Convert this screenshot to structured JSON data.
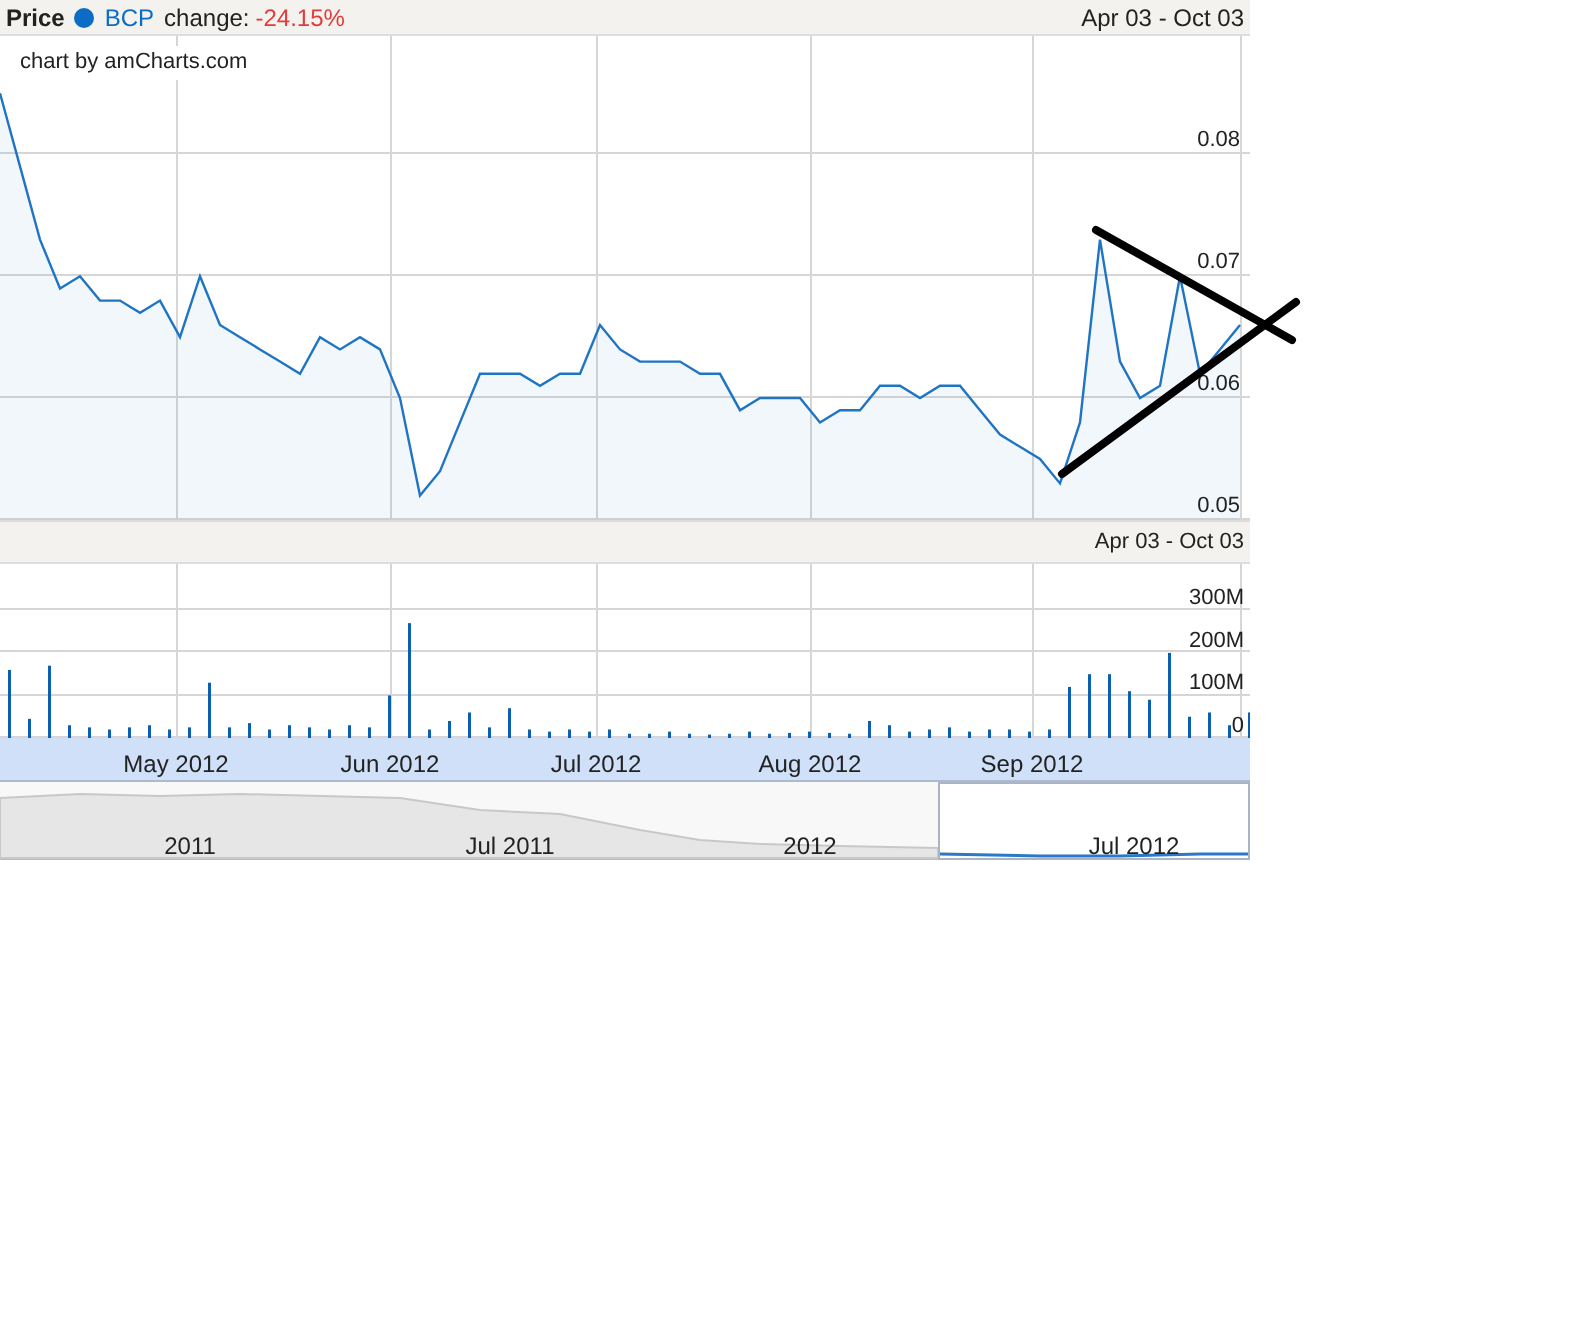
{
  "price_panel": {
    "title": "Price",
    "legend": {
      "color": "#0a6cc4",
      "change_label": "change:",
      "change": "-24.15%"
    },
    "range": "Apr 03 - Oct 03",
    "credit": "chart by amCharts.com",
    "chart_data": {
      "type": "area",
      "grid": true,
      "ylim": [
        0.05,
        0.0897
      ],
      "yticks": [
        {
          "value": 0.05,
          "label": "0.05"
        },
        {
          "value": 0.06,
          "label": "0.06"
        },
        {
          "value": 0.07,
          "label": "0.07"
        },
        {
          "value": 0.08,
          "label": "0.08"
        }
      ],
      "series": [
        {
          "name": "BCP",
          "color": "#1f74c4",
          "values": [
            0.085,
            0.079,
            0.073,
            0.069,
            0.07,
            0.068,
            0.068,
            0.067,
            0.068,
            0.065,
            0.07,
            0.066,
            0.065,
            0.064,
            0.063,
            0.062,
            0.065,
            0.064,
            0.065,
            0.064,
            0.06,
            0.052,
            0.054,
            0.058,
            0.062,
            0.062,
            0.062,
            0.061,
            0.062,
            0.062,
            0.066,
            0.064,
            0.063,
            0.063,
            0.063,
            0.062,
            0.062,
            0.059,
            0.06,
            0.06,
            0.06,
            0.058,
            0.059,
            0.059,
            0.061,
            0.061,
            0.06,
            0.061,
            0.061,
            0.059,
            0.057,
            0.056,
            0.055,
            0.053,
            0.058,
            0.073,
            0.063,
            0.06,
            0.061,
            0.07,
            0.062,
            0.064,
            0.066
          ]
        }
      ]
    }
  },
  "volume_panel": {
    "range": "Apr 03 - Oct 03",
    "chart_data": {
      "type": "bar",
      "grid": true,
      "ylim": [
        0,
        409
      ],
      "yticks": [
        {
          "value": 0,
          "label": "0"
        },
        {
          "value": 100,
          "label": "100M"
        },
        {
          "value": 200,
          "label": "200M"
        },
        {
          "value": 300,
          "label": "300M"
        }
      ],
      "series": [
        {
          "color": "#0a5fb0",
          "values": [
            160,
            45,
            170,
            30,
            25,
            20,
            25,
            30,
            20,
            25,
            130,
            25,
            35,
            20,
            30,
            25,
            20,
            30,
            25,
            100,
            270,
            20,
            40,
            60,
            25,
            70,
            20,
            15,
            20,
            15,
            20,
            10,
            10,
            15,
            10,
            8,
            10,
            15,
            10,
            12,
            15,
            12,
            10,
            40,
            30,
            15,
            20,
            25,
            15,
            20,
            20,
            15,
            20,
            120,
            150,
            150,
            110,
            90,
            200,
            50,
            60,
            30,
            60
          ]
        }
      ]
    }
  },
  "date_axis": {
    "labels": [
      "May 2012",
      "Jun 2012",
      "Jul 2012",
      "Aug 2012",
      "Sep 2012"
    ]
  },
  "navigator": {
    "labels": [
      "2011",
      "Jul 2011",
      "2012",
      "Jul 2012"
    ]
  }
}
